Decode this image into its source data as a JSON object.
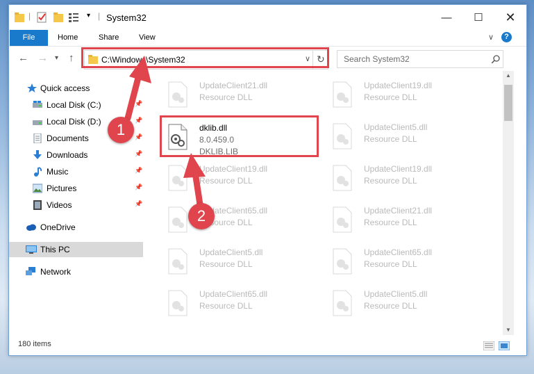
{
  "window": {
    "title": "System32"
  },
  "ribbon": {
    "tabs": [
      "File",
      "Home",
      "Share",
      "View"
    ]
  },
  "address": {
    "path": "C:\\Windows\\System32"
  },
  "search": {
    "placeholder": "Search System32"
  },
  "nav": {
    "items": [
      {
        "label": "Quick access",
        "icon": "star-icon",
        "pinned": false
      },
      {
        "label": "Local Disk (C:)",
        "icon": "drive-icon",
        "pinned": true
      },
      {
        "label": "Local Disk (D:)",
        "icon": "drive-icon",
        "pinned": true
      },
      {
        "label": "Documents",
        "icon": "documents-icon",
        "pinned": true
      },
      {
        "label": "Downloads",
        "icon": "downloads-icon",
        "pinned": true
      },
      {
        "label": "Music",
        "icon": "music-icon",
        "pinned": true
      },
      {
        "label": "Pictures",
        "icon": "pictures-icon",
        "pinned": true
      },
      {
        "label": "Videos",
        "icon": "videos-icon",
        "pinned": true
      },
      {
        "label": "OneDrive",
        "icon": "onedrive-icon",
        "pinned": false
      },
      {
        "label": "This PC",
        "icon": "pc-icon",
        "pinned": false,
        "selected": true
      },
      {
        "label": "Network",
        "icon": "network-icon",
        "pinned": false
      }
    ]
  },
  "files": {
    "highlighted": {
      "name": "dklib.dll",
      "version": "8.0.459.0",
      "description": "DKLIB.LIB"
    },
    "faded": [
      {
        "name": "UpdateClient21.dll",
        "type": "Resource DLL"
      },
      {
        "name": "UpdateClient19.dll",
        "type": "Resource DLL"
      },
      {
        "name": "UpdateClient5.dll",
        "type": "Resource DLL"
      },
      {
        "name": "UpdateClient19.dll",
        "type": "Resource DLL"
      },
      {
        "name": "UpdateClient19.dll",
        "type": "Resource DLL"
      },
      {
        "name": "UpdateClient65.dll",
        "type": "Resource DLL"
      },
      {
        "name": "UpdateClient21.dll",
        "type": "Resource DLL"
      },
      {
        "name": "UpdateClient5.dll",
        "type": "Resource DLL"
      },
      {
        "name": "UpdateClient65.dll",
        "type": "Resource DLL"
      },
      {
        "name": "UpdateClient65.dll",
        "type": "Resource DLL"
      },
      {
        "name": "UpdateClient5.dll",
        "type": "Resource DLL"
      }
    ]
  },
  "status": {
    "item_count": "180 items"
  },
  "annotations": {
    "step1": "1",
    "step2": "2",
    "accent_color": "#e0454d"
  }
}
